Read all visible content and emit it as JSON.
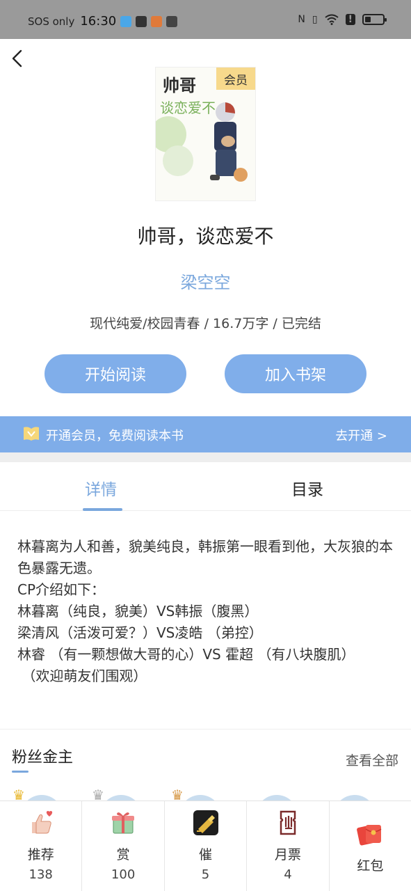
{
  "status_bar": {
    "carrier": "SOS only",
    "time": "16:30"
  },
  "book": {
    "cover_title_line1": "帅哥",
    "cover_title_line2": "谈恋爱不",
    "cover_badge": "会员",
    "title": "帅哥，谈恋爱不",
    "author": "梁空空",
    "meta": "现代纯爱/校园青春 / 16.7万字 / 已完结"
  },
  "actions": {
    "read_label": "开始阅读",
    "shelf_label": "加入书架"
  },
  "vip_banner": {
    "text": "开通会员，免费阅读本书",
    "action": "去开通 >"
  },
  "tabs": [
    {
      "label": "详情",
      "active": true
    },
    {
      "label": "目录",
      "active": false
    }
  ],
  "description": [
    "林暮离为人和善，貌美纯良，韩振第一眼看到他，大灰狼的本色暴露无遗。",
    "CP介绍如下：",
    "林暮离（纯良，貌美）VS韩振（腹黑）",
    "梁清风（活泼可爱？）VS凌皓 （弟控）",
    "林睿 （有一颗想做大哥的心）VS 霍超 （有八块腹肌）",
    " （欢迎萌友们围观）"
  ],
  "fans": {
    "title": "粉丝金主",
    "view_all": "查看全部"
  },
  "bottom_bar": [
    {
      "label": "推荐",
      "count": "138",
      "icon": "thumbs-up-icon"
    },
    {
      "label": "赏",
      "count": "100",
      "icon": "gift-icon"
    },
    {
      "label": "催",
      "count": "5",
      "icon": "urge-icon"
    },
    {
      "label": "月票",
      "count": "4",
      "icon": "ticket-icon"
    },
    {
      "label": "红包",
      "count": "",
      "icon": "red-envelope-icon"
    }
  ],
  "colors": {
    "accent": "#7aa7dd",
    "button": "#80aeea",
    "status_bar": "#9a9a9a"
  }
}
